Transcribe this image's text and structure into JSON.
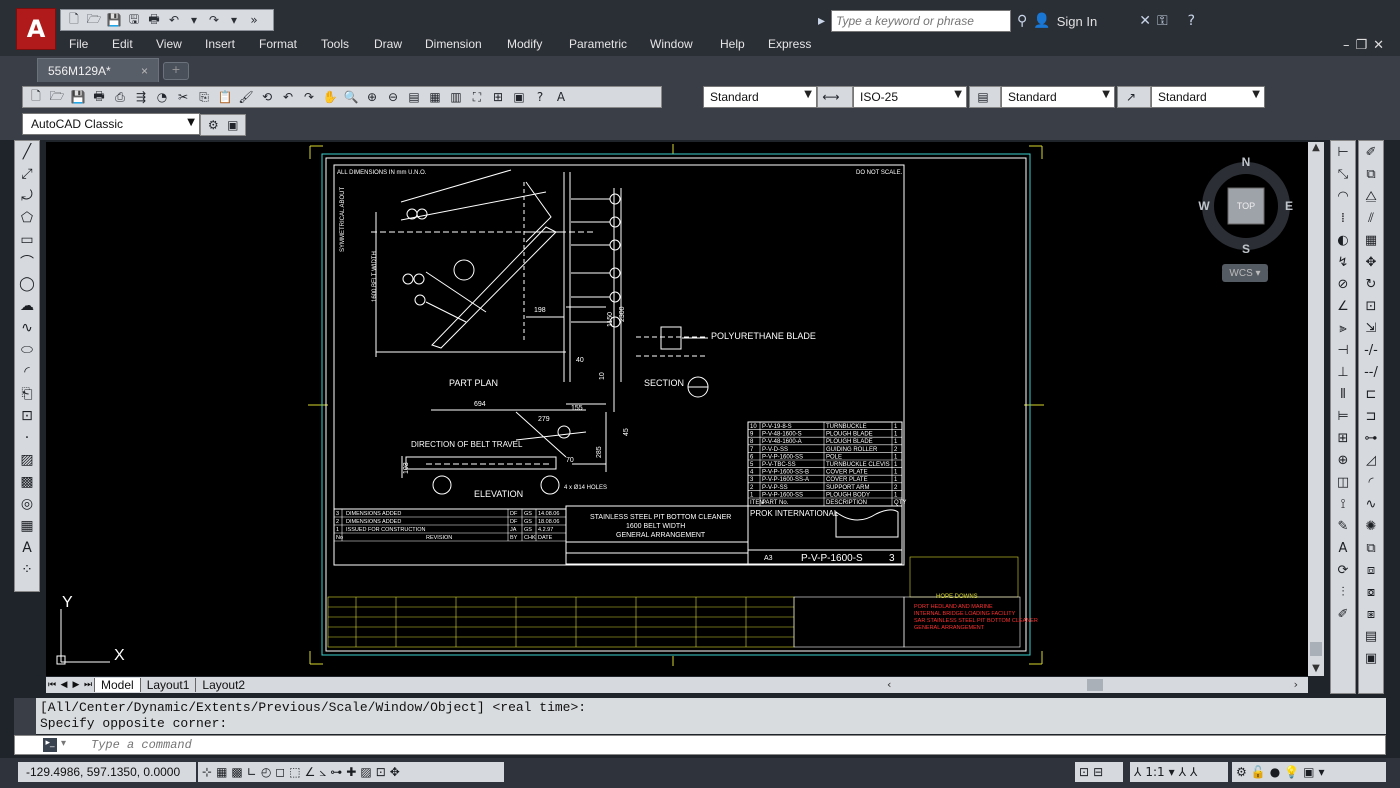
{
  "app": {
    "logo_letter": "A",
    "search_placeholder": "Type a keyword or phrase",
    "sign_in": "Sign In",
    "accent": "#b11a1a"
  },
  "menu": [
    "File",
    "Edit",
    "View",
    "Insert",
    "Format",
    "Tools",
    "Draw",
    "Dimension",
    "Modify",
    "Parametric",
    "Window",
    "Help",
    "Express"
  ],
  "document_tab": {
    "name": "556M129A*",
    "close": "×"
  },
  "styles": {
    "text_style": "Standard",
    "dim_style": "ISO-25",
    "table_style": "Standard",
    "mleader_style": "Standard"
  },
  "workspace": "AutoCAD Classic",
  "viewcube": {
    "n": "N",
    "s": "S",
    "e": "E",
    "w": "W",
    "face": "TOP",
    "wcs": "WCS"
  },
  "ucs": {
    "x": "X",
    "y": "Y"
  },
  "layout_tabs": [
    "Model",
    "Layout1",
    "Layout2"
  ],
  "command": {
    "history_1": "[All/Center/Dynamic/Extents/Previous/Scale/Window/Object] <real time>:",
    "history_2": "Specify opposite corner:",
    "placeholder": "Type a command"
  },
  "status": {
    "coords": "-129.4986, 597.1350, 0.0000",
    "scale": "1:1"
  },
  "drawing": {
    "note_dims": "ALL DIMENSIONS IN mm U.N.O.",
    "note_scale": "DO NOT SCALE.",
    "part_plan": "PART PLAN",
    "section": "SECTION",
    "polyurethane": "POLYURETHANE BLADE",
    "elevation": "ELEVATION",
    "belt_dir": "DIRECTION OF BELT TRAVEL",
    "holes": "4 x Ø14 HOLES",
    "title_1": "STAINLESS STEEL PIT BOTTOM CLEANER",
    "title_2": "1600 BELT WIDTH",
    "title_3": "GENERAL ARRANGEMENT",
    "company": "PROK INTERNATIONAL",
    "drawing_no": "P-V-P-1600-S",
    "sheet": "3",
    "size": "A3",
    "dims": [
      "198",
      "1150",
      "2300",
      "694",
      "279",
      "155",
      "45",
      "285",
      "70",
      "103",
      "40",
      "10"
    ],
    "label_symmetrical": "SYMMETRICAL ABOUT",
    "label_belt_width": "1600 BELT WIDTH",
    "bom_rows": [
      [
        "10",
        "P-V-19-8-S",
        "TURNBUCKLE",
        "1"
      ],
      [
        "9",
        "P-V-48-1600-S",
        "PLOUGH BLADE",
        "1"
      ],
      [
        "8",
        "P-V-48-1600-A",
        "PLOUGH BLADE",
        "1"
      ],
      [
        "7",
        "P-V-D-SS",
        "GUIDING ROLLER",
        "2"
      ],
      [
        "6",
        "P-V-P-1600-SS",
        "POLE",
        "1"
      ],
      [
        "5",
        "P-V-TBC-SS",
        "TURNBUCKLE CLEVIS",
        "1"
      ],
      [
        "4",
        "P-V-P-1600-SS-B",
        "COVER PLATE",
        "1"
      ],
      [
        "3",
        "P-V-P-1600-SS-A",
        "COVER PLATE",
        "1"
      ],
      [
        "2",
        "P-V-P-SS",
        "SUPPORT ARM",
        "2"
      ],
      [
        "1",
        "P-V-P-1600-SS",
        "PLOUGH BODY",
        "1"
      ]
    ],
    "bom_header": [
      "ITEM",
      "PART No.",
      "DESCRIPTION",
      "QTY"
    ],
    "rev_rows": [
      [
        "3",
        "DIMENSIONS ADDED",
        "DF",
        "GS",
        "14.08.06"
      ],
      [
        "2",
        "DIMENSIONS ADDED",
        "DF",
        "GS",
        "18.08.06"
      ],
      [
        "1",
        "ISSUED FOR CONSTRUCTION",
        "JA",
        "GS",
        "4.2.97"
      ]
    ],
    "rev_header": [
      "No",
      "REVISION",
      "BY",
      "CHK",
      "DATE"
    ],
    "red_block": [
      "PORT HEDLAND AND MARINE",
      "INTERNAL BRIDGE LOADING FACILITY",
      "SAR STAINLESS STEEL PIT BOTTOM CLEANER",
      "GENERAL ARRANGEMENT"
    ],
    "yellow_label": "HOPE DOWNS"
  }
}
